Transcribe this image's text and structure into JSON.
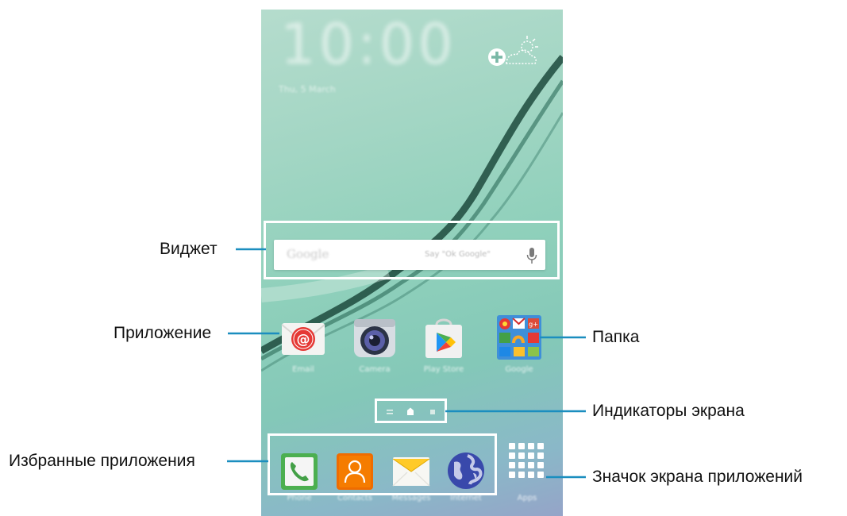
{
  "callouts": {
    "widget": "Виджет",
    "app": "Приложение",
    "folder": "Папка",
    "indicators": "Индикаторы экрана",
    "favorites": "Избранные приложения",
    "apps_screen": "Значок экрана приложений"
  },
  "phone": {
    "clock": "10:00",
    "date": "Thu, 5 March",
    "search": {
      "logo": "Google",
      "hint": "Say \"Ok Google\""
    },
    "apps": [
      {
        "label": "Email",
        "icon": "email-icon"
      },
      {
        "label": "Camera",
        "icon": "camera-icon"
      },
      {
        "label": "Play Store",
        "icon": "play-store-icon"
      },
      {
        "label": "Google",
        "icon": "google-folder-icon"
      }
    ],
    "dock": [
      {
        "label": "Phone",
        "icon": "phone-icon"
      },
      {
        "label": "Contacts",
        "icon": "contacts-icon"
      },
      {
        "label": "Messages",
        "icon": "messages-icon"
      },
      {
        "label": "Internet",
        "icon": "internet-icon"
      },
      {
        "label": "Apps",
        "icon": "apps-grid-icon"
      }
    ]
  },
  "colors": {
    "callout_line": "#1b8ebf",
    "highlight_box": "#ffffff"
  }
}
